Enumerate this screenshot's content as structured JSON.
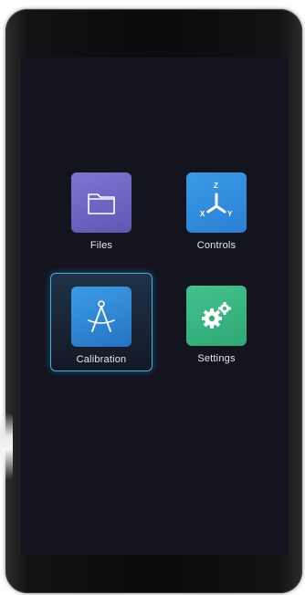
{
  "menu": {
    "items": [
      {
        "label": "Files",
        "icon": "folder-icon",
        "color": "#6a64c4",
        "selected": false
      },
      {
        "label": "Controls",
        "icon": "xyz-axes-icon",
        "color": "#2f8ddd",
        "selected": false
      },
      {
        "label": "Calibration",
        "icon": "compass-icon",
        "color": "#2f86d4",
        "selected": true
      },
      {
        "label": "Settings",
        "icon": "gears-icon",
        "color": "#39b480",
        "selected": false
      }
    ]
  },
  "controls_icon": {
    "axis_z": "Z",
    "axis_x": "X",
    "axis_y": "Y"
  },
  "colors": {
    "screen_bg": "#14141f",
    "selection_border": "#35b3ee"
  }
}
